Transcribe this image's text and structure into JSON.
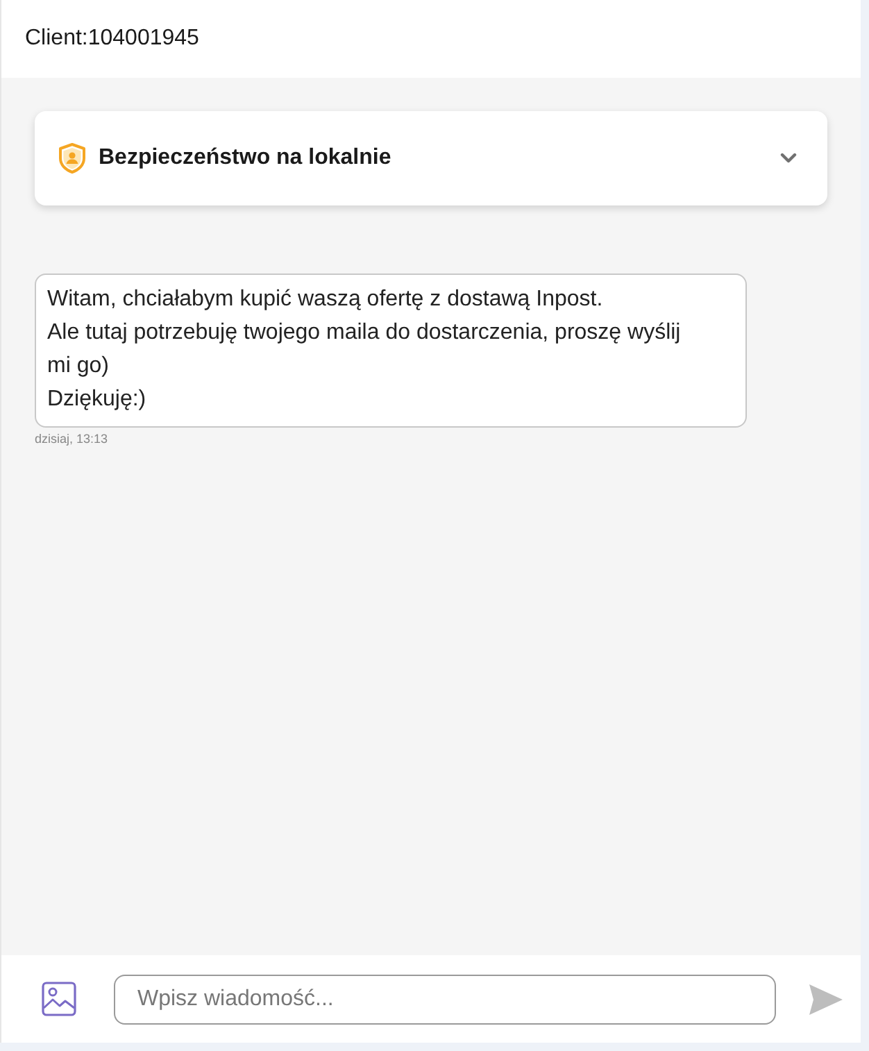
{
  "header": {
    "title": "Client:104001945"
  },
  "security_panel": {
    "title": "Bezpieczeństwo na lokalnie",
    "expanded": false
  },
  "messages": [
    {
      "text": "Witam, chciałabym kupić waszą ofertę z dostawą Inpost.\nAle tutaj potrzebuję twojego maila do dostarczenia, proszę wyślij mi go)\nDziękuję:)",
      "time": "dzisiaj, 13:13"
    }
  ],
  "composer": {
    "placeholder": "Wpisz wiadomość..."
  }
}
